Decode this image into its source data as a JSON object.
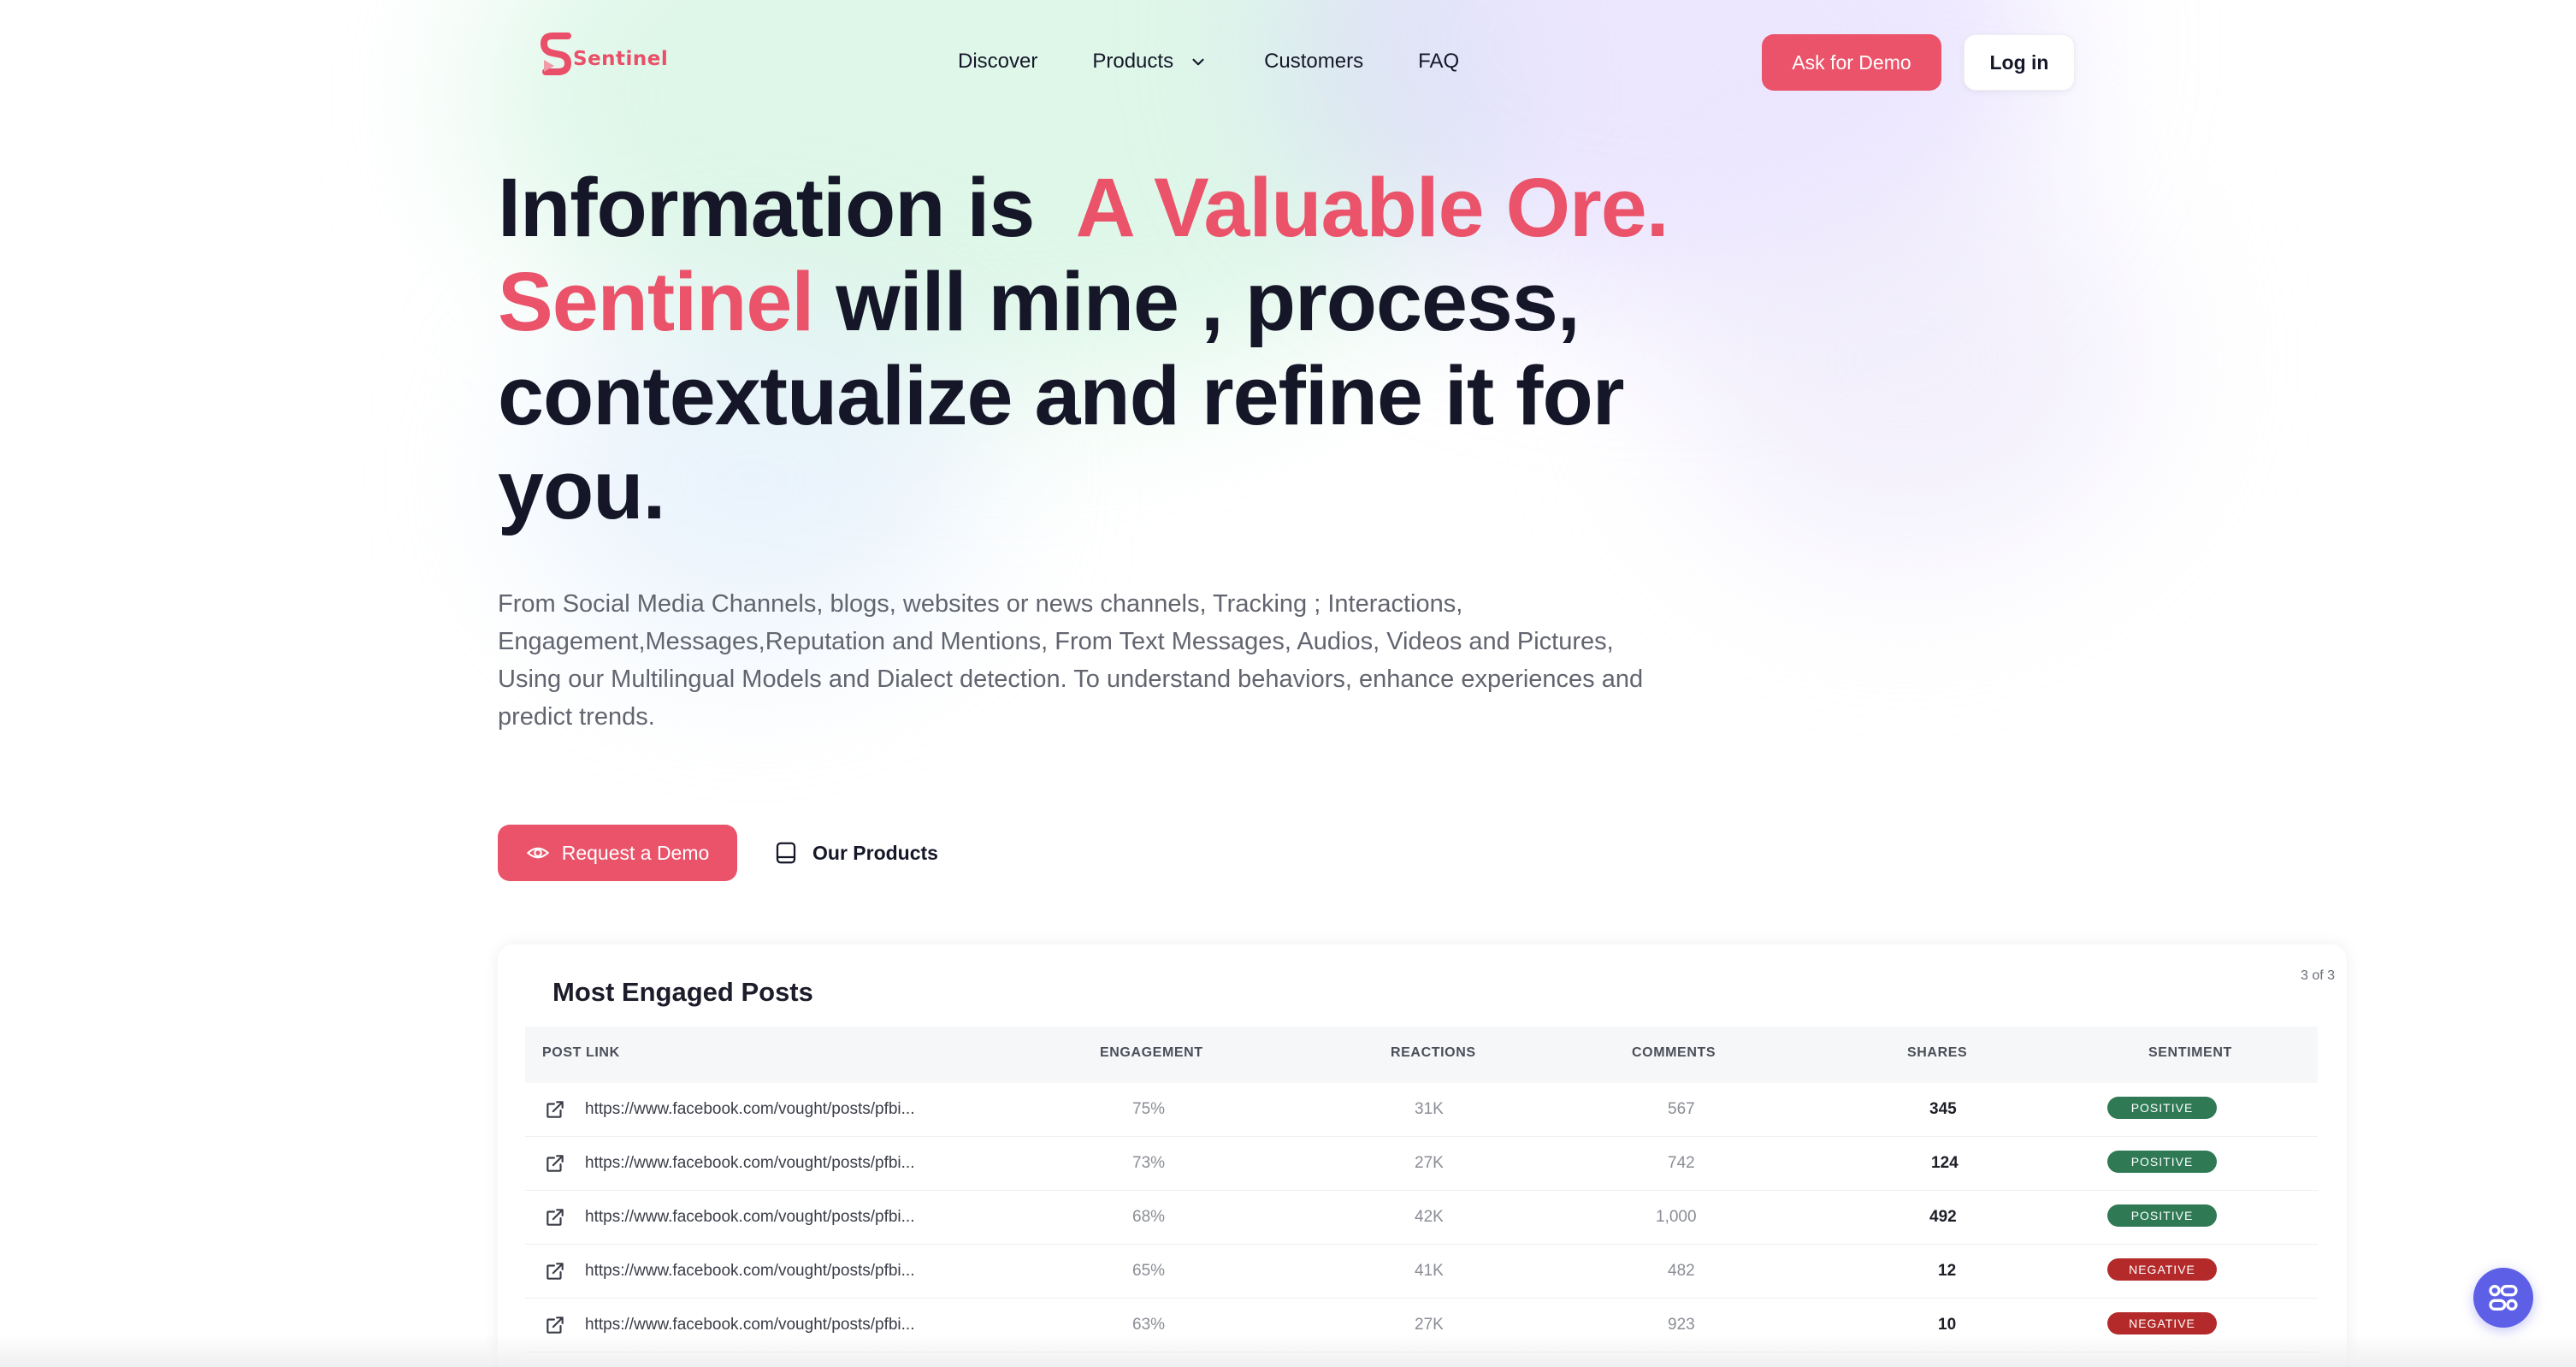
{
  "brand": {
    "name": "Sentinel",
    "accent": "#ea5369",
    "fab_color": "#5d5fe6"
  },
  "nav": {
    "links": [
      "Discover",
      "Products",
      "Customers",
      "FAQ"
    ],
    "products_icon": "chevron-down-icon",
    "demo_label": "Ask for Demo",
    "login_label": "Log in"
  },
  "hero": {
    "line1_plain": "Information is",
    "line1_accent": "A Valuable Ore.",
    "line2_accent": "Sentinel",
    "line2_plain": "will mine , process,",
    "line3": "contextualize and refine it for",
    "line4": "you.",
    "description": "From Social Media Channels, blogs, websites or news channels, Tracking ; Interactions, Engagement,Messages,Reputation and Mentions, From Text Messages, Audios, Videos and Pictures, Using our Multilingual Models and Dialect detection. To understand behaviors, enhance experiences and predict trends.",
    "request_label": "Request a Demo",
    "request_icon": "eye-icon",
    "products_label": "Our Products",
    "products_icon": "tablet-icon"
  },
  "table": {
    "title": "Most Engaged Posts",
    "pager": "3 of 3",
    "columns": [
      "POST LINK",
      "ENGAGEMENT",
      "REACTIONS",
      "COMMENTS",
      "SHARES",
      "SENTIMENT"
    ],
    "rows": [
      {
        "link": "https://www.facebook.com/vought/posts/pfbi...",
        "engagement": "75%",
        "reactions": "31K",
        "comments": "567",
        "shares": "345",
        "sentiment": "POSITIVE",
        "color": "#2f7a55"
      },
      {
        "link": "https://www.facebook.com/vought/posts/pfbi...",
        "engagement": "73%",
        "reactions": "27K",
        "comments": "742",
        "shares": "124",
        "sentiment": "POSITIVE",
        "color": "#2f7a55"
      },
      {
        "link": "https://www.facebook.com/vought/posts/pfbi...",
        "engagement": "68%",
        "reactions": "42K",
        "comments": "1,000",
        "shares": "492",
        "sentiment": "POSITIVE",
        "color": "#2f7a55"
      },
      {
        "link": "https://www.facebook.com/vought/posts/pfbi...",
        "engagement": "65%",
        "reactions": "41K",
        "comments": "482",
        "shares": "12",
        "sentiment": "NEGATIVE",
        "color": "#b42a2a"
      },
      {
        "link": "https://www.facebook.com/vought/posts/pfbi...",
        "engagement": "63%",
        "reactions": "27K",
        "comments": "923",
        "shares": "10",
        "sentiment": "NEGATIVE",
        "color": "#b42a2a"
      }
    ]
  },
  "fab_icon": "apps-icon"
}
